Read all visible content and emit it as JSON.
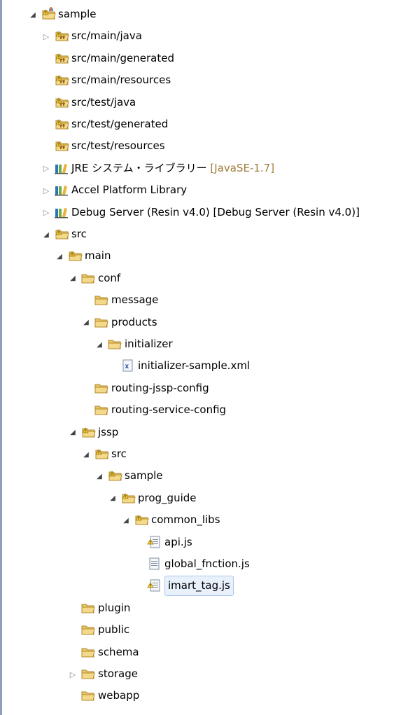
{
  "tree": [
    {
      "label": "sample",
      "decoration": "",
      "depth": 0,
      "twisty": "expanded",
      "icon": "project-icon"
    },
    {
      "label": "src/main/java",
      "decoration": "",
      "depth": 1,
      "twisty": "collapsed",
      "icon": "source-folder-icon"
    },
    {
      "label": "src/main/generated",
      "decoration": "",
      "depth": 1,
      "twisty": "none",
      "icon": "source-folder-icon"
    },
    {
      "label": "src/main/resources",
      "decoration": "",
      "depth": 1,
      "twisty": "none",
      "icon": "source-folder-icon"
    },
    {
      "label": "src/test/java",
      "decoration": "",
      "depth": 1,
      "twisty": "none",
      "icon": "source-folder-icon"
    },
    {
      "label": "src/test/generated",
      "decoration": "",
      "depth": 1,
      "twisty": "none",
      "icon": "source-folder-icon"
    },
    {
      "label": "src/test/resources",
      "decoration": "",
      "depth": 1,
      "twisty": "none",
      "icon": "source-folder-icon"
    },
    {
      "label": "JRE システム・ライブラリー",
      "decoration": "[JavaSE-1.7]",
      "depth": 1,
      "twisty": "collapsed",
      "icon": "library-icon"
    },
    {
      "label": "Accel Platform Library",
      "decoration": "",
      "depth": 1,
      "twisty": "collapsed",
      "icon": "library-icon"
    },
    {
      "label": "Debug Server (Resin v4.0) [Debug Server (Resin v4.0)]",
      "decoration": "",
      "depth": 1,
      "twisty": "collapsed",
      "icon": "library-icon"
    },
    {
      "label": "src",
      "decoration": "",
      "depth": 1,
      "twisty": "expanded",
      "icon": "folder-warning-icon"
    },
    {
      "label": "main",
      "decoration": "",
      "depth": 2,
      "twisty": "expanded",
      "icon": "folder-warning-icon"
    },
    {
      "label": "conf",
      "decoration": "",
      "depth": 3,
      "twisty": "expanded",
      "icon": "folder-icon"
    },
    {
      "label": "message",
      "decoration": "",
      "depth": 4,
      "twisty": "none",
      "icon": "folder-icon"
    },
    {
      "label": "products",
      "decoration": "",
      "depth": 4,
      "twisty": "expanded",
      "icon": "folder-icon"
    },
    {
      "label": "initializer",
      "decoration": "",
      "depth": 5,
      "twisty": "expanded",
      "icon": "folder-icon"
    },
    {
      "label": "initializer-sample.xml",
      "decoration": "",
      "depth": 6,
      "twisty": "none",
      "icon": "xml-file-icon"
    },
    {
      "label": "routing-jssp-config",
      "decoration": "",
      "depth": 4,
      "twisty": "none",
      "icon": "folder-icon"
    },
    {
      "label": "routing-service-config",
      "decoration": "",
      "depth": 4,
      "twisty": "none",
      "icon": "folder-icon"
    },
    {
      "label": "jssp",
      "decoration": "",
      "depth": 3,
      "twisty": "expanded",
      "icon": "folder-warning-icon"
    },
    {
      "label": "src",
      "decoration": "",
      "depth": 4,
      "twisty": "expanded",
      "icon": "folder-warning-icon"
    },
    {
      "label": "sample",
      "decoration": "",
      "depth": 5,
      "twisty": "expanded",
      "icon": "folder-warning-icon"
    },
    {
      "label": "prog_guide",
      "decoration": "",
      "depth": 6,
      "twisty": "expanded",
      "icon": "folder-warning-icon"
    },
    {
      "label": "common_libs",
      "decoration": "",
      "depth": 7,
      "twisty": "expanded",
      "icon": "folder-warning-icon"
    },
    {
      "label": "api.js",
      "decoration": "",
      "depth": 8,
      "twisty": "none",
      "icon": "js-file-warning-icon"
    },
    {
      "label": "global_fnction.js",
      "decoration": "",
      "depth": 8,
      "twisty": "none",
      "icon": "js-file-icon"
    },
    {
      "label": "imart_tag.js",
      "decoration": "",
      "depth": 8,
      "twisty": "none",
      "icon": "js-file-warning-icon",
      "selected": true
    },
    {
      "label": "plugin",
      "decoration": "",
      "depth": 3,
      "twisty": "none",
      "icon": "folder-icon"
    },
    {
      "label": "public",
      "decoration": "",
      "depth": 3,
      "twisty": "none",
      "icon": "folder-icon"
    },
    {
      "label": "schema",
      "decoration": "",
      "depth": 3,
      "twisty": "none",
      "icon": "folder-icon"
    },
    {
      "label": "storage",
      "decoration": "",
      "depth": 3,
      "twisty": "collapsed",
      "icon": "folder-icon"
    },
    {
      "label": "webapp",
      "decoration": "",
      "depth": 3,
      "twisty": "none",
      "icon": "folder-icon"
    }
  ]
}
